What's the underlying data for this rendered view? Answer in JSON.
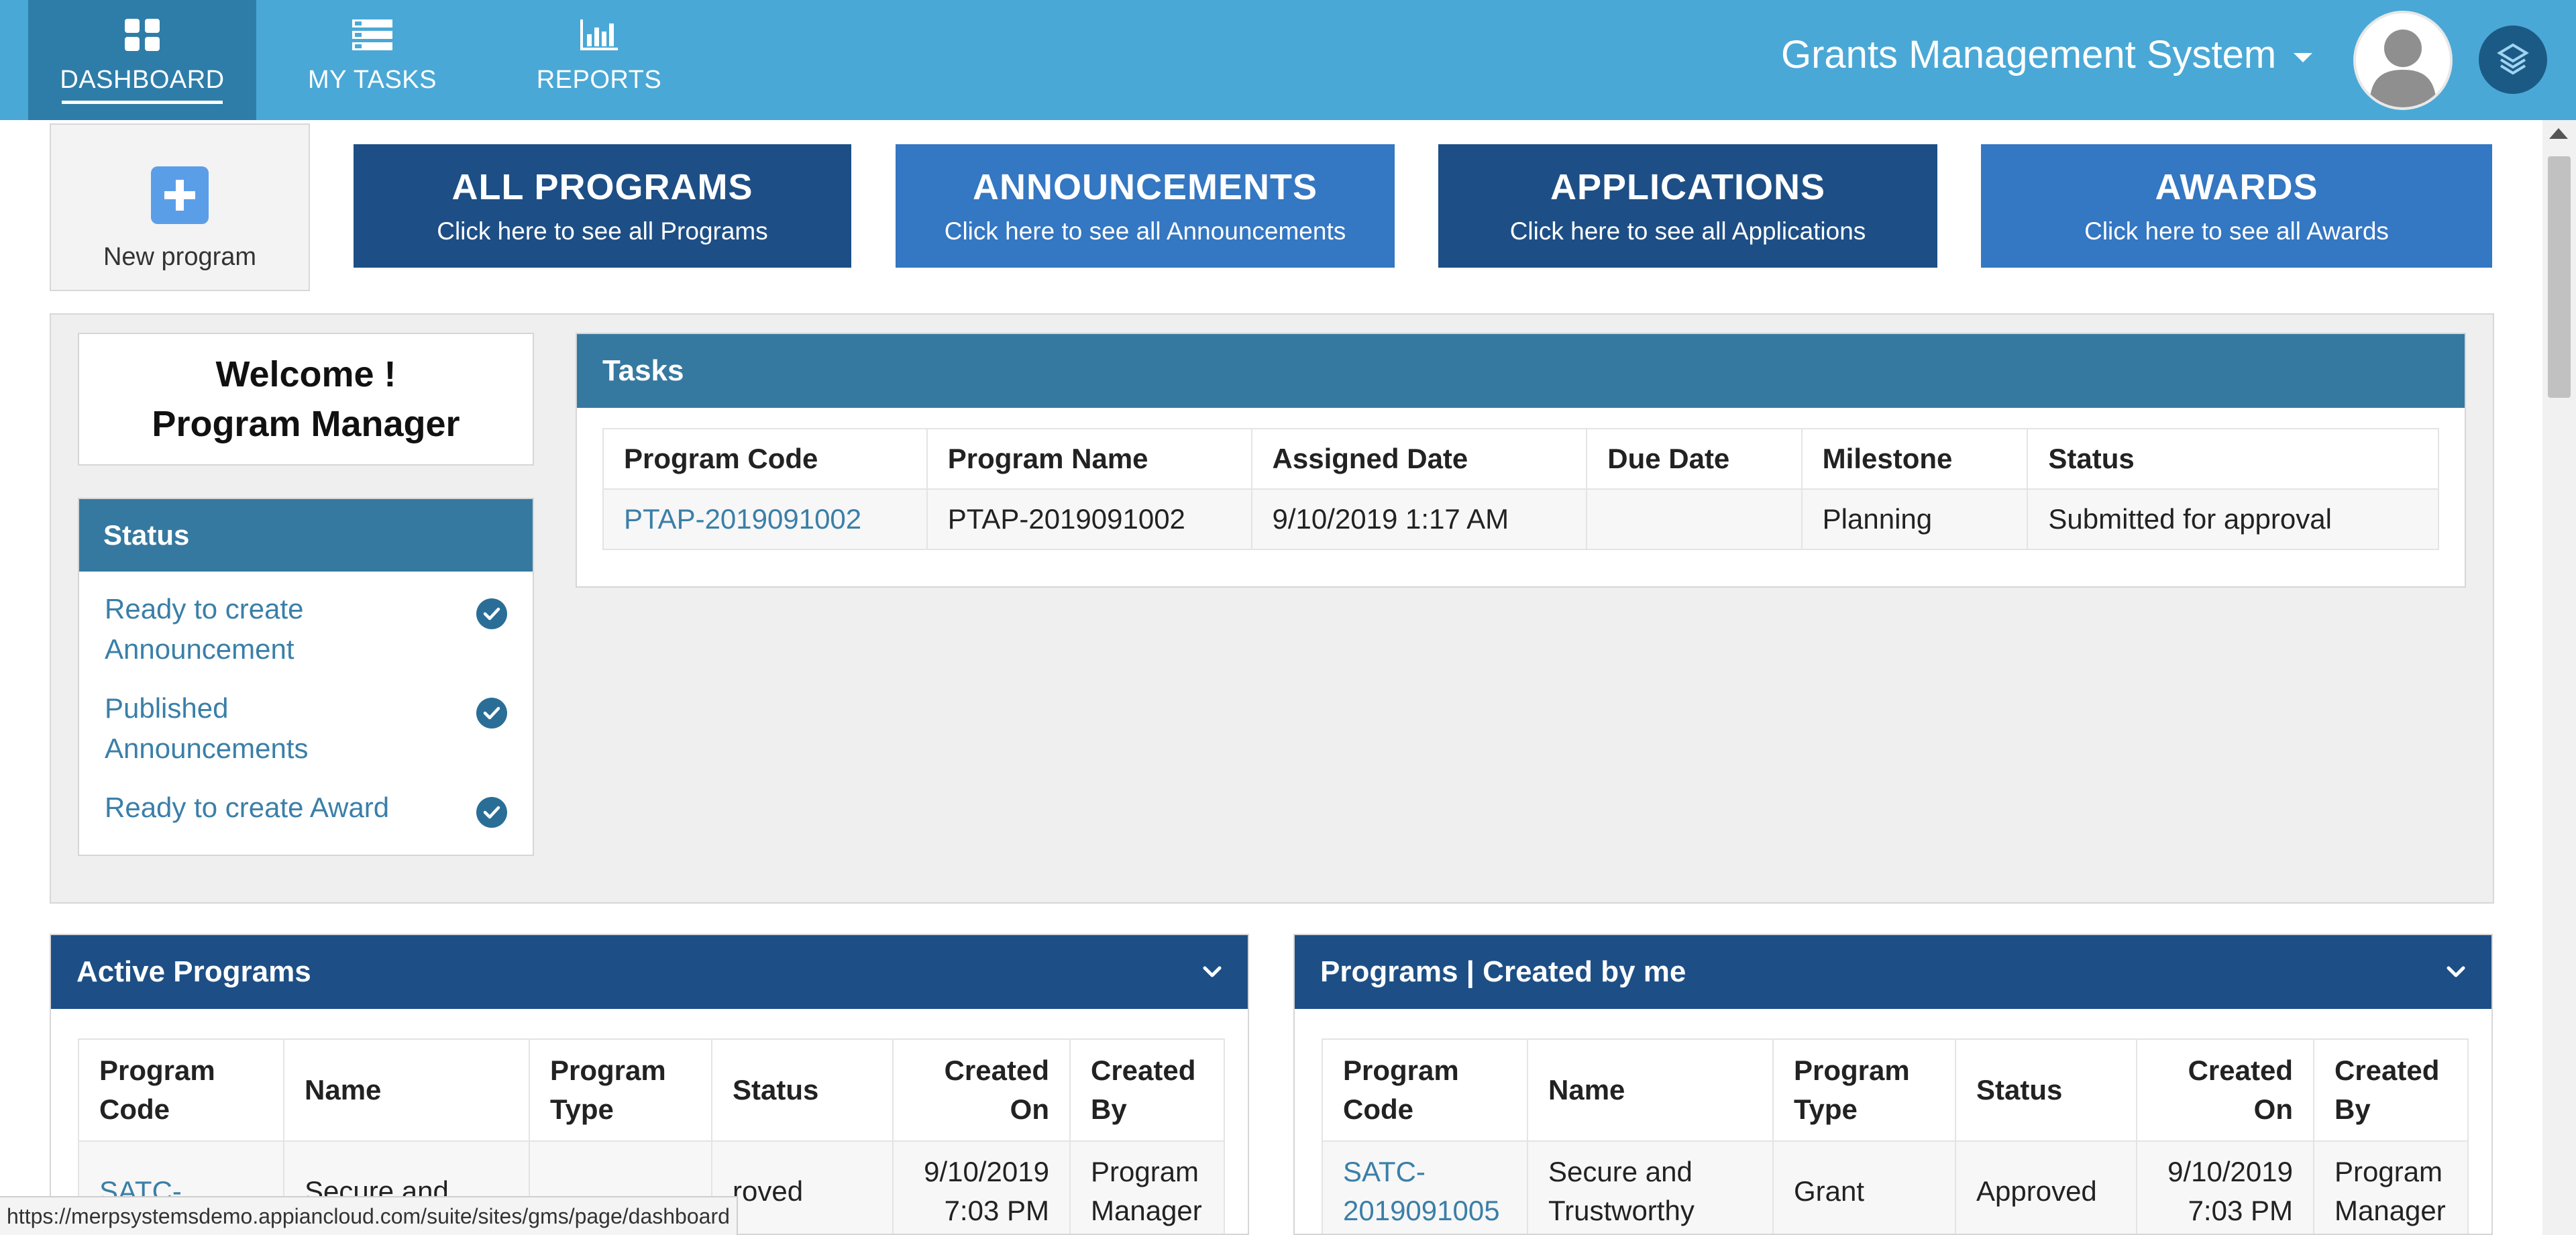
{
  "nav": {
    "items": [
      {
        "label": "DASHBOARD",
        "icon": "grid-icon",
        "active": true
      },
      {
        "label": "MY TASKS",
        "icon": "list-icon",
        "active": false
      },
      {
        "label": "REPORTS",
        "icon": "bar-chart-icon",
        "active": false
      }
    ],
    "app_title": "Grants Management System"
  },
  "new_program": {
    "label": "New program"
  },
  "tiles": [
    {
      "title": "ALL PROGRAMS",
      "subtitle": "Click here to see all Programs"
    },
    {
      "title": "ANNOUNCEMENTS",
      "subtitle": "Click here to see all Announcements"
    },
    {
      "title": "APPLICATIONS",
      "subtitle": "Click here to see all Applications"
    },
    {
      "title": "AWARDS",
      "subtitle": "Click here to see all Awards"
    }
  ],
  "welcome": {
    "line1": "Welcome !",
    "line2": "Program Manager"
  },
  "status": {
    "title": "Status",
    "items": [
      {
        "label": "Ready to create Announcement"
      },
      {
        "label": "Published Announcements"
      },
      {
        "label": "Ready to create Award"
      }
    ]
  },
  "tasks": {
    "title": "Tasks",
    "columns": [
      "Program Code",
      "Program Name",
      "Assigned Date",
      "Due Date",
      "Milestone",
      "Status"
    ],
    "rows": [
      {
        "program_code": "PTAP-2019091002",
        "program_name": "PTAP-2019091002",
        "assigned_date": "9/10/2019 1:17 AM",
        "due_date": "",
        "milestone": "Planning",
        "status": "Submitted for approval"
      }
    ]
  },
  "active_programs": {
    "title": "Active Programs",
    "columns": [
      "Program Code",
      "Name",
      "Program Type",
      "Status",
      "Created On",
      "Created By"
    ],
    "rows": [
      {
        "program_code": "SATC-",
        "name": "Secure and",
        "program_type": "",
        "status": "roved",
        "created_on": "9/10/2019 7:03 PM",
        "created_by": "Program Manager"
      }
    ]
  },
  "my_programs": {
    "title": "Programs | Created by me",
    "columns": [
      "Program Code",
      "Name",
      "Program Type",
      "Status",
      "Created On",
      "Created By"
    ],
    "rows": [
      {
        "program_code": "SATC-2019091005",
        "name": "Secure and Trustworthy",
        "program_type": "Grant",
        "status": "Approved",
        "created_on": "9/10/2019 7:03 PM",
        "created_by": "Program Manager"
      }
    ]
  },
  "status_bar": {
    "url": "https://merpsystemsdemo.appiancloud.com/suite/sites/gms/page/dashboard"
  },
  "colors": {
    "topbar": "#4aa8d6",
    "tile_dark": "#1d4f86",
    "tile_light": "#3477c2",
    "panel_header": "#3679a0",
    "link": "#3a7fa8"
  }
}
